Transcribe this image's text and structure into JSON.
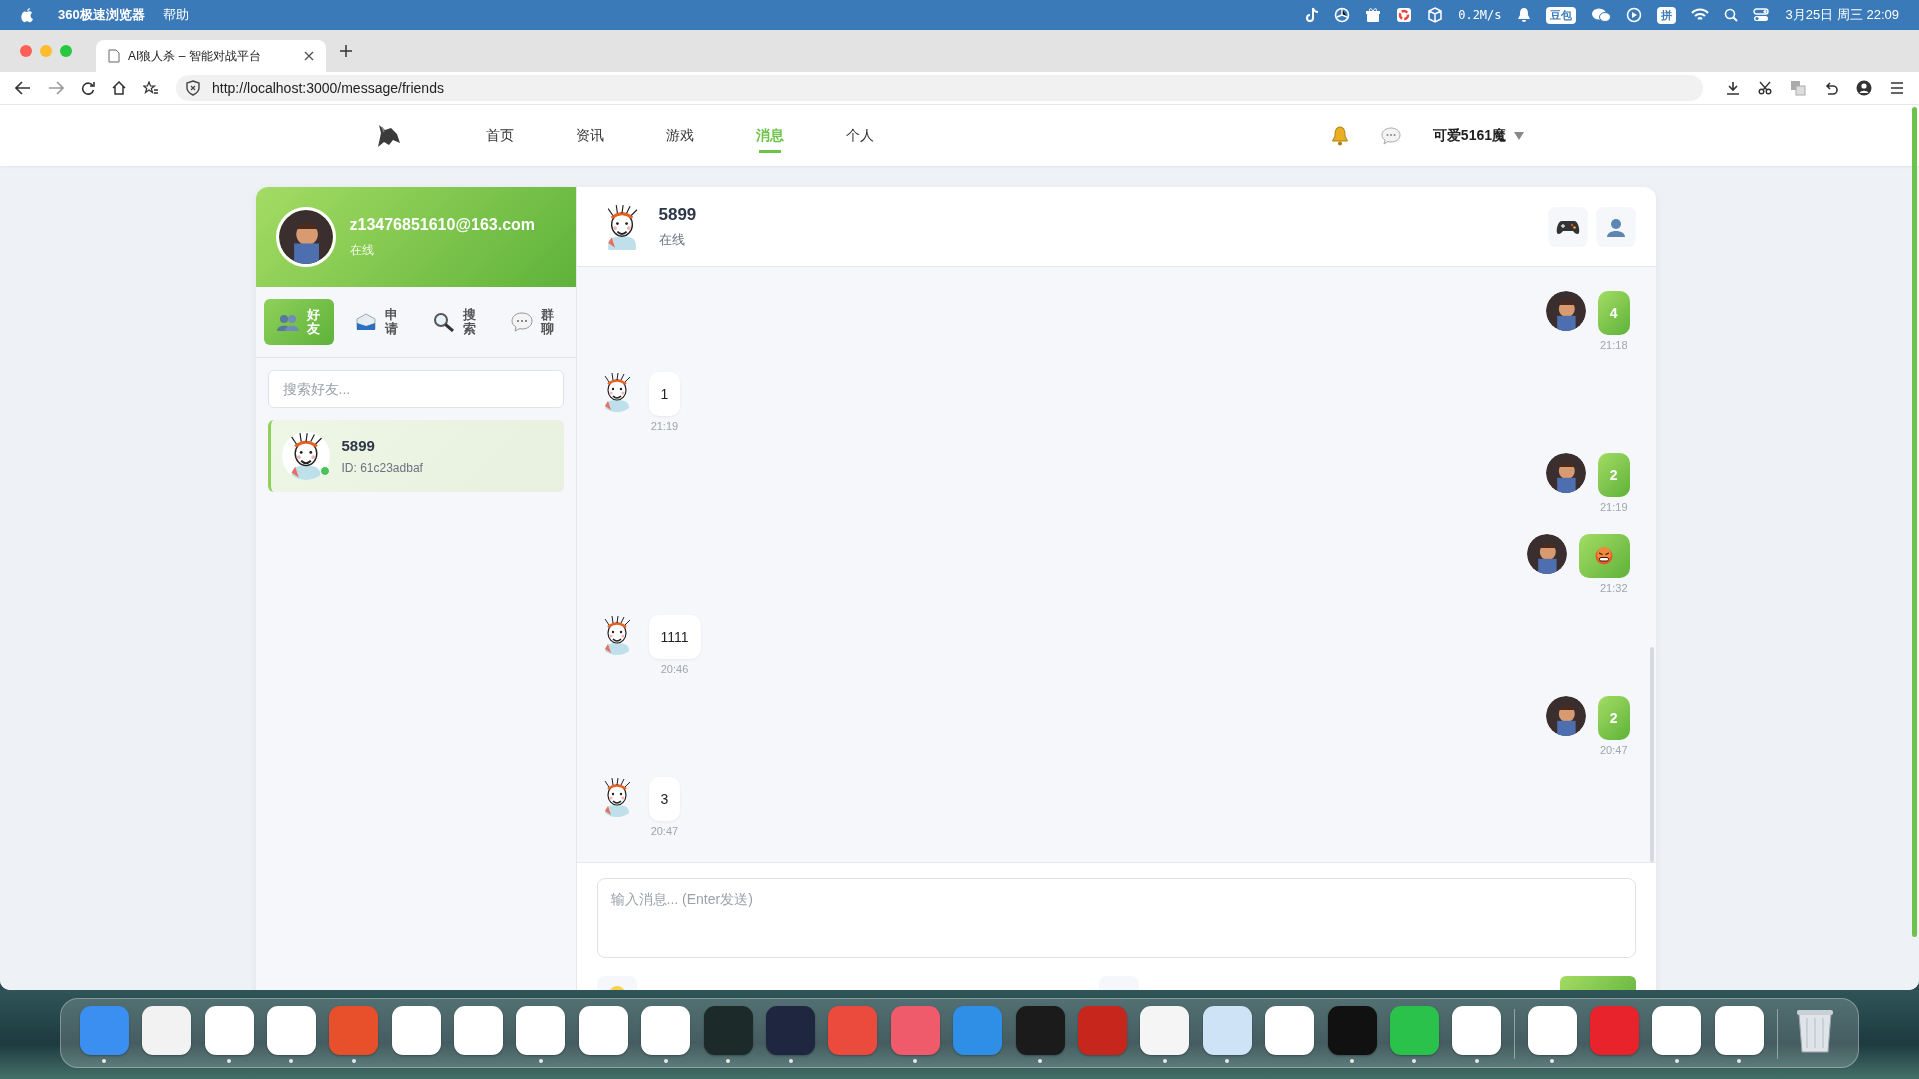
{
  "menu_bar": {
    "app_name": "360极速浏览器",
    "items": [
      "帮助"
    ],
    "net_speed": "0.2M/s",
    "badges": [
      "豆包",
      "拼"
    ],
    "clock": "3月25日 周三 22:09"
  },
  "browser": {
    "tab_title": "AI狼人杀 – 智能对战平台",
    "url": "http://localhost:3000/message/friends"
  },
  "nav": {
    "items": [
      {
        "label": "首页",
        "selected": false
      },
      {
        "label": "资讯",
        "selected": false
      },
      {
        "label": "游戏",
        "selected": false
      },
      {
        "label": "消息",
        "selected": true
      },
      {
        "label": "个人",
        "selected": false
      }
    ],
    "user": "可爱5161魔"
  },
  "profile": {
    "email": "z13476851610@163.com",
    "status": "在线"
  },
  "tabs": [
    {
      "kind": "friends",
      "label": "好友",
      "selected": true
    },
    {
      "kind": "requests",
      "label": "申请",
      "selected": false
    },
    {
      "kind": "search",
      "label": "搜索",
      "selected": false
    },
    {
      "kind": "groups",
      "label": "群聊",
      "selected": false
    }
  ],
  "friend_search": {
    "placeholder": "搜索好友..."
  },
  "friends": [
    {
      "name": "5899",
      "id": "ID: 61c23adbaf",
      "selected": true,
      "online": true
    }
  ],
  "chat": {
    "name": "5899",
    "status": "在线",
    "messages": [
      {
        "outgoing": true,
        "kind": "text",
        "text": "4",
        "time": "21:18"
      },
      {
        "outgoing": false,
        "kind": "text",
        "text": "1",
        "time": "21:19"
      },
      {
        "outgoing": true,
        "kind": "text",
        "text": "2",
        "time": "21:19"
      },
      {
        "outgoing": true,
        "kind": "emoji",
        "time": "21:32"
      },
      {
        "outgoing": false,
        "kind": "text",
        "text": "1111",
        "time": "20:46"
      },
      {
        "outgoing": true,
        "kind": "text",
        "text": "2",
        "time": "20:47"
      },
      {
        "outgoing": false,
        "kind": "text",
        "text": "3",
        "time": "20:47"
      }
    ],
    "input": {
      "placeholder": "输入消息... (Enter发送)"
    }
  },
  "dock": [
    {
      "color": "#3b8ff0",
      "running": true
    },
    {
      "color": "#f2f2f2",
      "running": false
    },
    {
      "color": "#ffffff",
      "running": true
    },
    {
      "color": "#ffffff",
      "running": true
    },
    {
      "color": "#e8502c",
      "running": true
    },
    {
      "color": "#ffffff",
      "running": false
    },
    {
      "color": "#ffffff",
      "running": false
    },
    {
      "color": "#ffffff",
      "running": true
    },
    {
      "color": "#ffffff",
      "running": false
    },
    {
      "color": "#ffffff",
      "running": true
    },
    {
      "color": "#1c2a2a",
      "running": true
    },
    {
      "color": "#1f2740",
      "running": true
    },
    {
      "color": "#ea4b3d",
      "running": false
    },
    {
      "color": "#ef5b6b",
      "running": true
    },
    {
      "color": "#2f8fe6",
      "running": false
    },
    {
      "color": "#1b1b1b",
      "running": true
    },
    {
      "color": "#c7261c",
      "running": false
    },
    {
      "color": "#f5f5f5",
      "running": true
    },
    {
      "color": "#cfe3f7",
      "running": true
    },
    {
      "color": "#ffffff",
      "running": false
    },
    {
      "color": "#111111",
      "running": true
    },
    {
      "color": "#2bc24c",
      "running": true
    },
    {
      "color": "#ffffff",
      "running": true
    },
    {
      "color": "#ffffff",
      "running": true
    },
    {
      "color": "#e8232b",
      "running": false
    },
    {
      "color": "#ffffff",
      "running": true
    },
    {
      "color": "#ffffff",
      "running": true
    }
  ]
}
